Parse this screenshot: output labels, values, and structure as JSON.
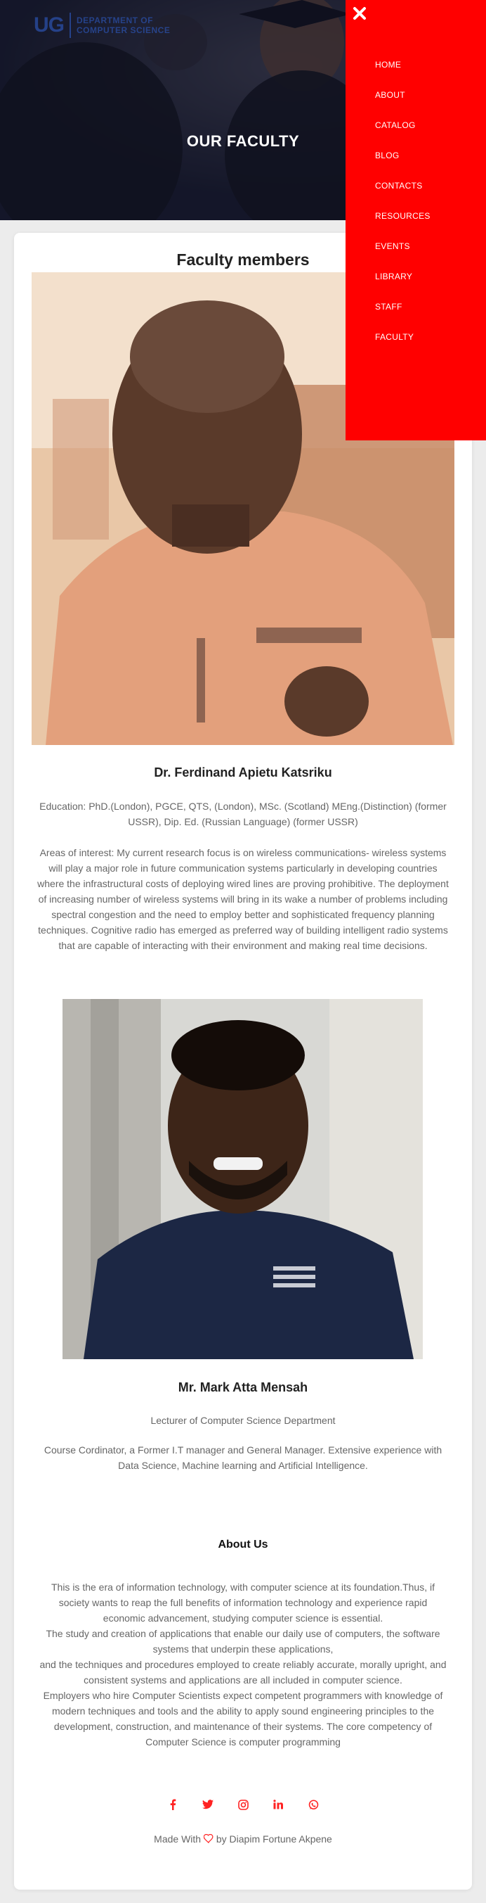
{
  "header": {
    "logo_mark": "UG",
    "logo_text_line1": "DEPARTMENT OF",
    "logo_text_line2": "COMPUTER SCIENCE",
    "title": "OUR FACULTY"
  },
  "menu": {
    "close_icon": "close-icon",
    "items": [
      "HOME",
      "ABOUT",
      "CATALOG",
      "BLOG",
      "CONTACTS",
      "RESOURCES",
      "EVENTS",
      "LIBRARY",
      "STAFF",
      "FACULTY"
    ]
  },
  "main": {
    "section_title": "Faculty members",
    "faculty": [
      {
        "name": "Dr. Ferdinand Apietu Katsriku",
        "education": "Education: PhD.(London), PGCE, QTS, (London), MSc. (Scotland) MEng.(Distinction) (former USSR), Dip. Ed. (Russian Language) (former USSR)",
        "bio": "Areas of interest: My current research focus is on wireless communications- wireless systems will play a major role in future communication systems particularly in developing countries where the infrastructural costs of deploying wired lines are proving prohibitive. The deployment of increasing number of wireless systems will bring in its wake a number of problems including spectral congestion and the need to employ better and sophisticated frequency planning techniques. Cognitive radio has emerged as preferred way of building intelligent radio systems that are capable of interacting with their environment and making real time decisions."
      },
      {
        "name": "Mr. Mark Atta Mensah",
        "role": "Lecturer of Computer Science Department",
        "bio": "Course Cordinator, a Former I.T manager and General Manager. Extensive experience with Data Science, Machine learning and Artificial Intelligence."
      }
    ]
  },
  "about": {
    "title": "About Us",
    "text": "This is the era of information technology, with computer science at its foundation.Thus, if society wants to reap the full benefits of information technology and experience rapid economic advancement, studying computer science is essential.\nThe study and creation of applications that enable our daily use of computers, the software systems that underpin these applications,\nand the techniques and procedures employed to create reliably accurate, morally upright, and consistent systems and applications are all included in computer science.\nEmployers who hire Computer Scientists expect competent programmers with knowledge of modern techniques and tools and the ability to apply sound engineering principles to the development, construction, and maintenance of their systems. The core competency of Computer Science is computer programming"
  },
  "footer": {
    "socials": [
      "facebook-icon",
      "twitter-icon",
      "instagram-icon",
      "linkedin-icon",
      "whatsapp-icon"
    ],
    "credit_prefix": "Made With",
    "credit_suffix": "by Diapim Fortune Akpene"
  },
  "colors": {
    "accent": "#ff0000"
  }
}
